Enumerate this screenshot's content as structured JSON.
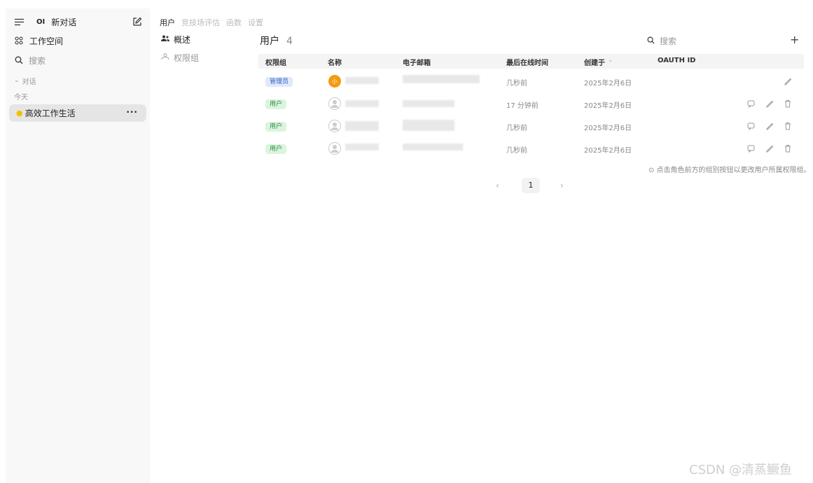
{
  "sidebar": {
    "new_chat_label": "新对话",
    "logo_text": "OI",
    "workspace_label": "工作空间",
    "search_label": "搜索",
    "section_label": "对话",
    "group_label": "今天",
    "chat_title": "高效工作生活",
    "more_label": "···"
  },
  "tabs": [
    {
      "label": "用户"
    },
    {
      "label": "竞技场评估"
    },
    {
      "label": "函数"
    },
    {
      "label": "设置"
    }
  ],
  "subnav": [
    {
      "label": "概述"
    },
    {
      "label": "权限组"
    }
  ],
  "main": {
    "title": "用户",
    "count": "4",
    "search_placeholder": "搜索",
    "add_label": "+"
  },
  "table": {
    "headers": [
      "权限组",
      "名称",
      "电子邮箱",
      "最后在线时间",
      "创建于",
      "OAUTH ID"
    ],
    "sort_indicator": "⌃",
    "rows": [
      {
        "role": "管理员",
        "avatar_char": "小",
        "last_online": "几秒前",
        "created": "2025年2月6日"
      },
      {
        "role": "用户",
        "avatar_char": "",
        "last_online": "17 分钟前",
        "created": "2025年2月6日"
      },
      {
        "role": "用户",
        "avatar_char": "",
        "last_online": "几秒前",
        "created": "2025年2月6日"
      },
      {
        "role": "用户",
        "avatar_char": "",
        "last_online": "几秒前",
        "created": "2025年2月6日"
      }
    ]
  },
  "note": "⊙ 点击角色前方的组别按钮以更改用户所属权限组。",
  "pagination": {
    "prev": "‹",
    "current": "1",
    "next": "›"
  },
  "watermark": "CSDN @清蒸鳜鱼",
  "colors": {
    "admin_badge": "#dfe9fb",
    "user_badge": "#dcf4df",
    "avatar_orange": "#f29b10"
  }
}
